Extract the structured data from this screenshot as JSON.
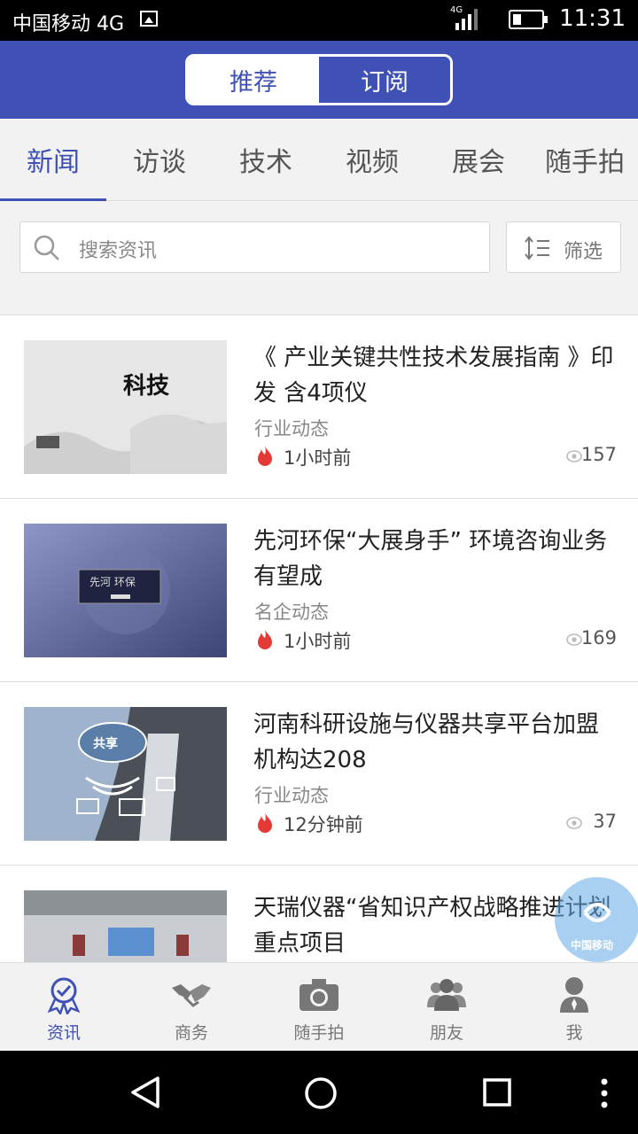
{
  "status_bar": {
    "carrier": "中国移动 4G",
    "network_badge": "4G",
    "time": "11:31",
    "battery_level": 0.3
  },
  "header": {
    "segments": [
      {
        "label": "推荐",
        "selected": true
      },
      {
        "label": "订阅",
        "selected": false
      }
    ]
  },
  "category_tabs": [
    {
      "label": "新闻",
      "active": true
    },
    {
      "label": "访谈",
      "active": false
    },
    {
      "label": "技术",
      "active": false
    },
    {
      "label": "视频",
      "active": false
    },
    {
      "label": "展会",
      "active": false
    },
    {
      "label": "随手拍",
      "active": false
    }
  ],
  "search": {
    "placeholder": "搜索资讯",
    "filter_label": "筛选"
  },
  "articles": [
    {
      "title": "《 产业关键共性技术发展指南 》印发 含4项仪",
      "category": "行业动态",
      "time": "1小时前",
      "views": "157",
      "thumb_text": "科技"
    },
    {
      "title": "先河环保“大展身手” 环境咨询业务有望成",
      "category": "名企动态",
      "time": "1小时前",
      "views": "169",
      "thumb_text": "先河 环保"
    },
    {
      "title": "河南科研设施与仪器共享平台加盟机构达208",
      "category": "行业动态",
      "time": "12分钟前",
      "views": "37",
      "thumb_text": "共享"
    },
    {
      "title": "天瑞仪器“省知识产权战略推进计划重点项目",
      "category": "",
      "time": "",
      "views": "",
      "thumb_text": ""
    }
  ],
  "floating_badge": {
    "label": "中国移动"
  },
  "bottom_nav": [
    {
      "label": "资讯",
      "icon": "badge-check-icon",
      "active": true
    },
    {
      "label": "商务",
      "icon": "handshake-icon",
      "active": false
    },
    {
      "label": "随手拍",
      "icon": "camera-icon",
      "active": false
    },
    {
      "label": "朋友",
      "icon": "people-icon",
      "active": false
    },
    {
      "label": "我",
      "icon": "person-icon",
      "active": false
    }
  ],
  "colors": {
    "primary": "#3f51b5",
    "fire": "#e53935",
    "background": "#f2f2f2"
  }
}
